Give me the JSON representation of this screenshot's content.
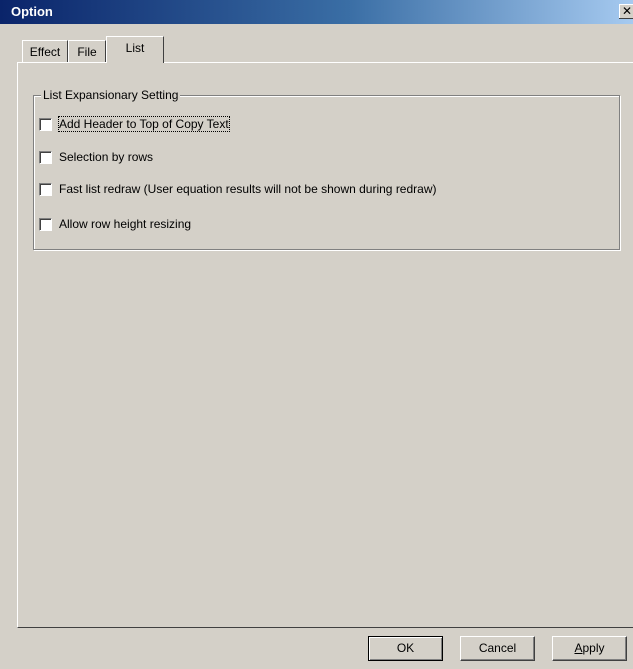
{
  "window": {
    "title": "Option",
    "close_glyph": "✕"
  },
  "tabs": [
    {
      "label": "Effect",
      "selected": false
    },
    {
      "label": "File",
      "selected": false
    },
    {
      "label": "List",
      "selected": true
    }
  ],
  "group": {
    "legend": "List Expansionary Setting",
    "options": [
      {
        "label": "Add Header to Top of Copy Text",
        "checked": false,
        "focused": true
      },
      {
        "label": "Selection by rows",
        "checked": false,
        "focused": false
      },
      {
        "label": "Fast list redraw (User equation results will not be shown during redraw)",
        "checked": false,
        "focused": false
      },
      {
        "label": "Allow row height resizing",
        "checked": false,
        "focused": false
      }
    ]
  },
  "buttons": {
    "ok": "OK",
    "cancel": "Cancel",
    "apply_first": "A",
    "apply_rest": "pply"
  },
  "colors": {
    "titlebar_start": "#0a246a",
    "titlebar_end": "#a6caf0",
    "face": "#d4d0c8"
  },
  "icons": {
    "close": "close-icon"
  }
}
